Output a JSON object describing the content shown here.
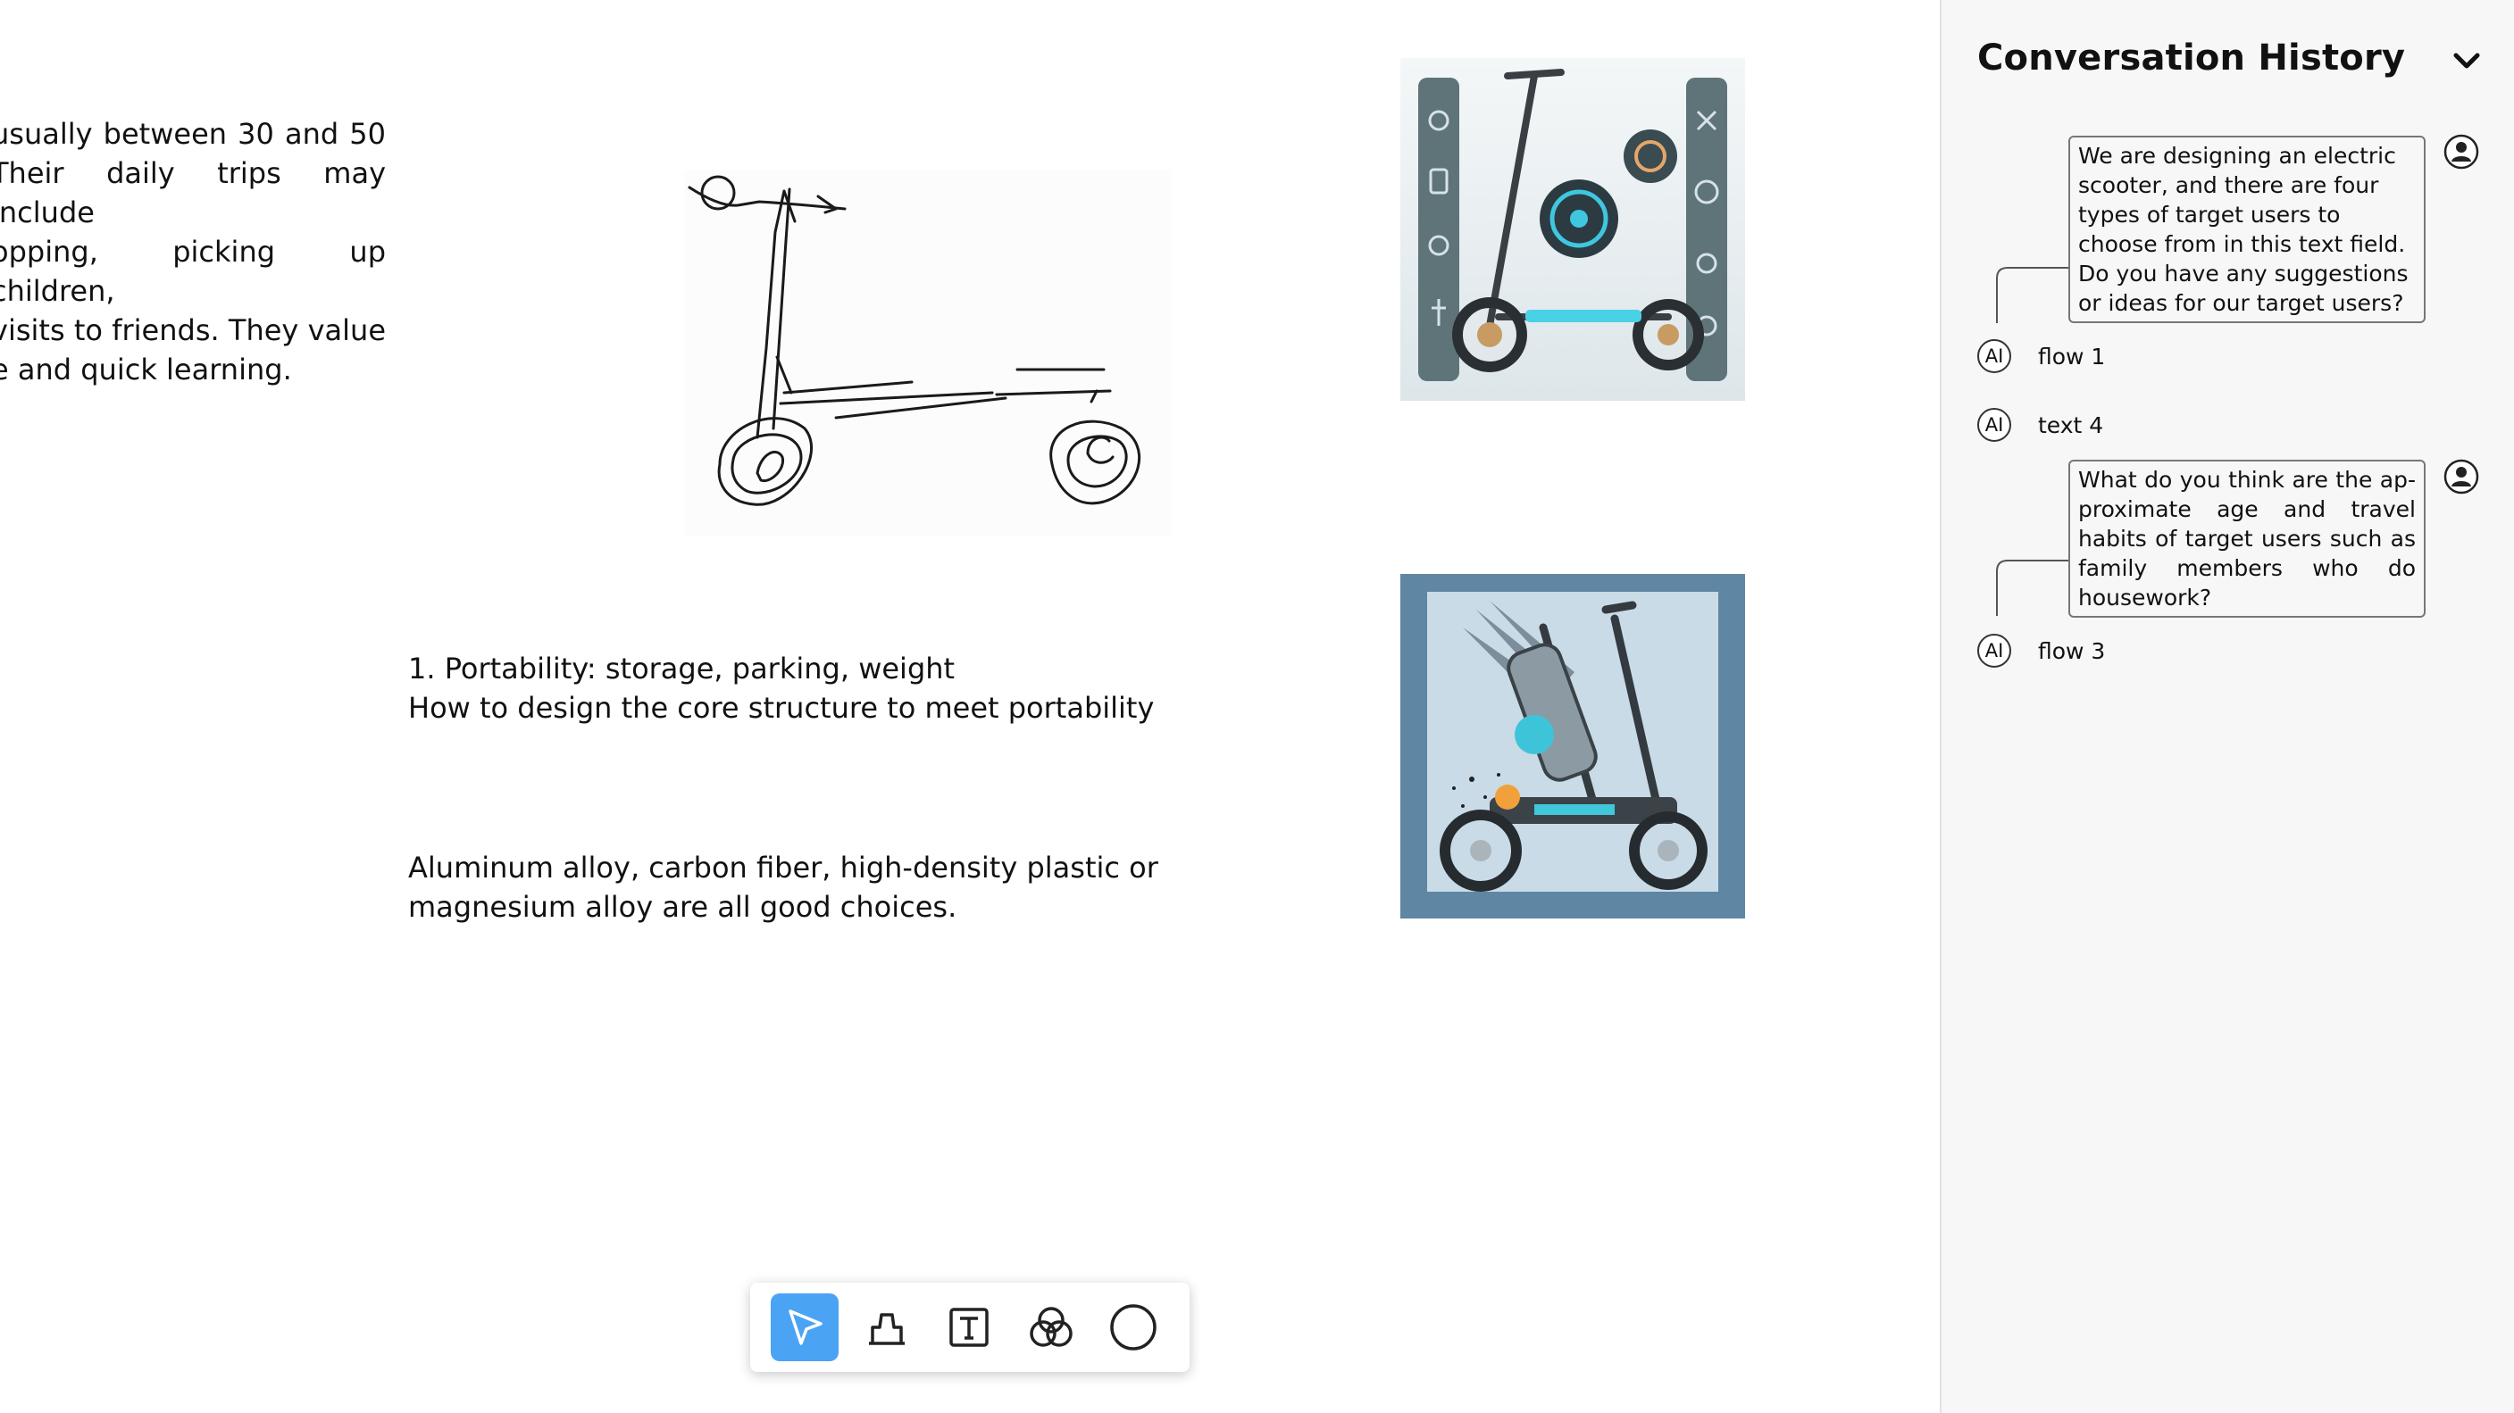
{
  "canvas": {
    "intro_lines": [
      "usually between 30 and 50",
      "Their daily trips may include",
      "opping, picking up children,",
      "visits to friends. They value",
      "e and quick learning."
    ],
    "note_portability": [
      "1. Portability: storage, parking, weight",
      "How to design the core structure to meet portability"
    ],
    "note_materials": [
      "Aluminum alloy, carbon fiber, high-density plastic or",
      "magnesium alloy are all good choices."
    ]
  },
  "toolbar": {
    "tools": [
      {
        "name": "select-tool",
        "icon": "cursor-arrow-icon",
        "active": true
      },
      {
        "name": "eraser-tool",
        "icon": "eraser-icon",
        "active": false
      },
      {
        "name": "text-tool",
        "icon": "text-box-icon",
        "active": false
      },
      {
        "name": "blend-tool",
        "icon": "overlapping-circles-icon",
        "active": false
      },
      {
        "name": "circle-tool",
        "icon": "circle-icon",
        "active": false
      }
    ],
    "accent_color": "#4ba3f4"
  },
  "panel": {
    "title": "Conversation History",
    "messages": [
      {
        "role": "user",
        "text": "We are designing an electric scooter, and there are four types of target users to choose from in this text field. Do you have any suggestions or ideas for our target users?"
      },
      {
        "role": "ai",
        "badge": "AI",
        "label": "flow 1"
      },
      {
        "role": "ai",
        "badge": "AI",
        "label": "text 4"
      },
      {
        "role": "user",
        "text": "What do you think are the ap-proximate age and travel habits of target users such as family members who do housework?"
      },
      {
        "role": "ai",
        "badge": "AI",
        "label": "flow 3"
      }
    ]
  }
}
